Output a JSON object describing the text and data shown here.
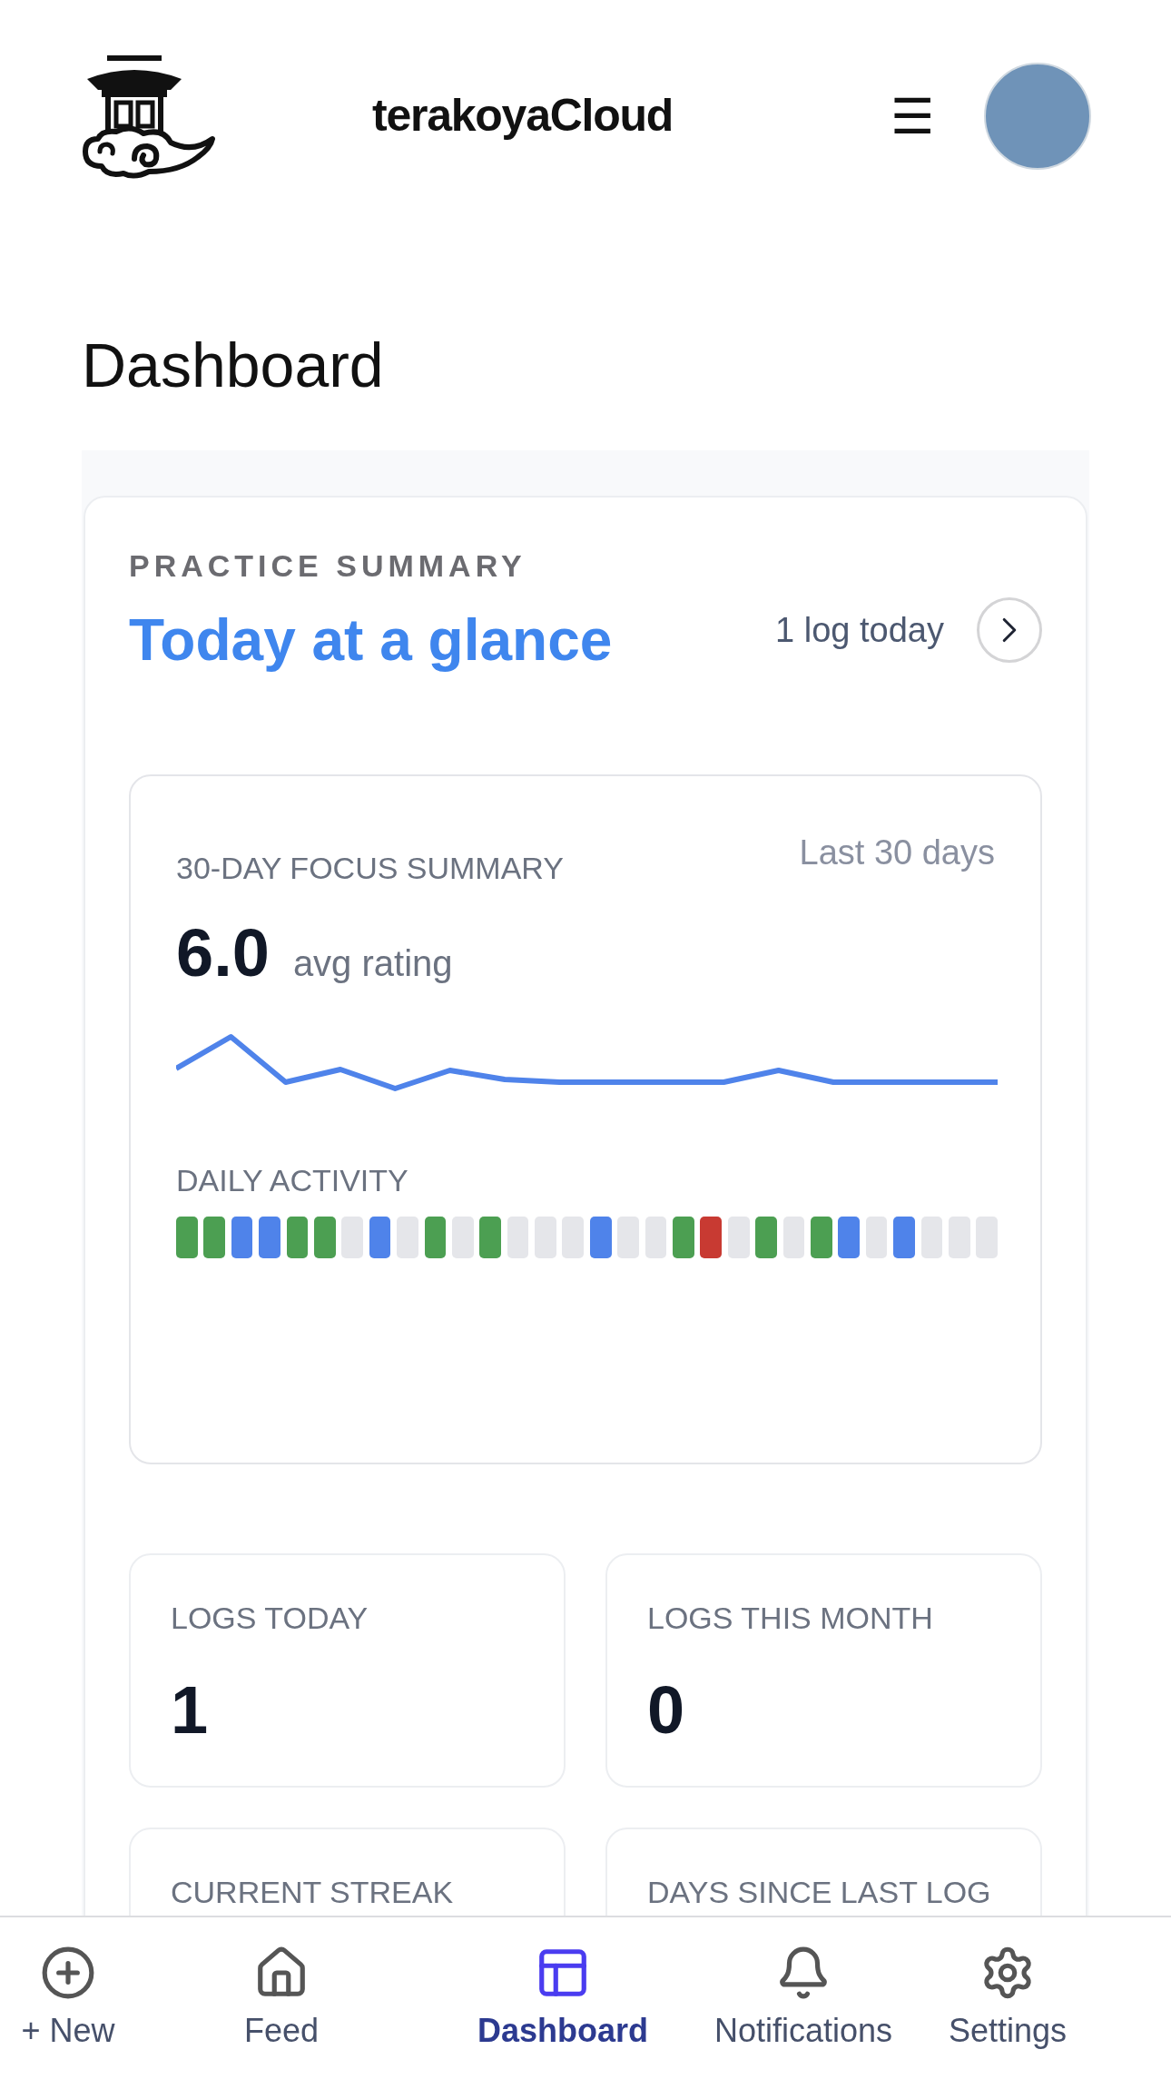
{
  "header": {
    "app_name": "terakoyaCloud",
    "menu_glyph": "☰"
  },
  "page_title": "Dashboard",
  "summary": {
    "eyebrow": "PRACTICE SUMMARY",
    "title": "Today at a glance",
    "log_count": "1 log today",
    "focus": {
      "label": "30-DAY FOCUS SUMMARY",
      "range": "Last 30 days",
      "value": "6.0",
      "unit": "avg rating",
      "activity_label": "DAILY ACTIVITY",
      "activity": [
        {
          "color": "#4c9f52"
        },
        {
          "color": "#4c9f52"
        },
        {
          "color": "#4f83ea"
        },
        {
          "color": "#4f83ea"
        },
        {
          "color": "#4c9f52"
        },
        {
          "color": "#4c9f52"
        },
        {
          "color": "#e5e6ea"
        },
        {
          "color": "#4f83ea"
        },
        {
          "color": "#e5e6ea"
        },
        {
          "color": "#4c9f52"
        },
        {
          "color": "#e5e6ea"
        },
        {
          "color": "#4c9f52"
        },
        {
          "color": "#e5e6ea"
        },
        {
          "color": "#e5e6ea"
        },
        {
          "color": "#e5e6ea"
        },
        {
          "color": "#4f83ea"
        },
        {
          "color": "#e5e6ea"
        },
        {
          "color": "#e5e6ea"
        },
        {
          "color": "#4c9f52"
        },
        {
          "color": "#c83a32"
        },
        {
          "color": "#e5e6ea"
        },
        {
          "color": "#4c9f52"
        },
        {
          "color": "#e5e6ea"
        },
        {
          "color": "#4c9f52"
        },
        {
          "color": "#4f83ea"
        },
        {
          "color": "#e5e6ea"
        },
        {
          "color": "#4f83ea"
        },
        {
          "color": "#e5e6ea"
        },
        {
          "color": "#e5e6ea"
        },
        {
          "color": "#e5e6ea"
        }
      ]
    },
    "stats": [
      {
        "label": "LOGS TODAY",
        "value": "1"
      },
      {
        "label": "LOGS THIS MONTH",
        "value": "0"
      },
      {
        "label": "CURRENT STREAK"
      },
      {
        "label": "DAYS SINCE LAST LOG"
      }
    ]
  },
  "nav": [
    {
      "kind": "new",
      "label": "+ New",
      "selected": false
    },
    {
      "kind": "feed",
      "label": "Feed",
      "selected": false
    },
    {
      "kind": "dashboard",
      "label": "Dashboard",
      "selected": true
    },
    {
      "kind": "notifications",
      "label": "Notifications",
      "selected": false
    },
    {
      "kind": "settings",
      "label": "Settings",
      "selected": false
    }
  ]
}
